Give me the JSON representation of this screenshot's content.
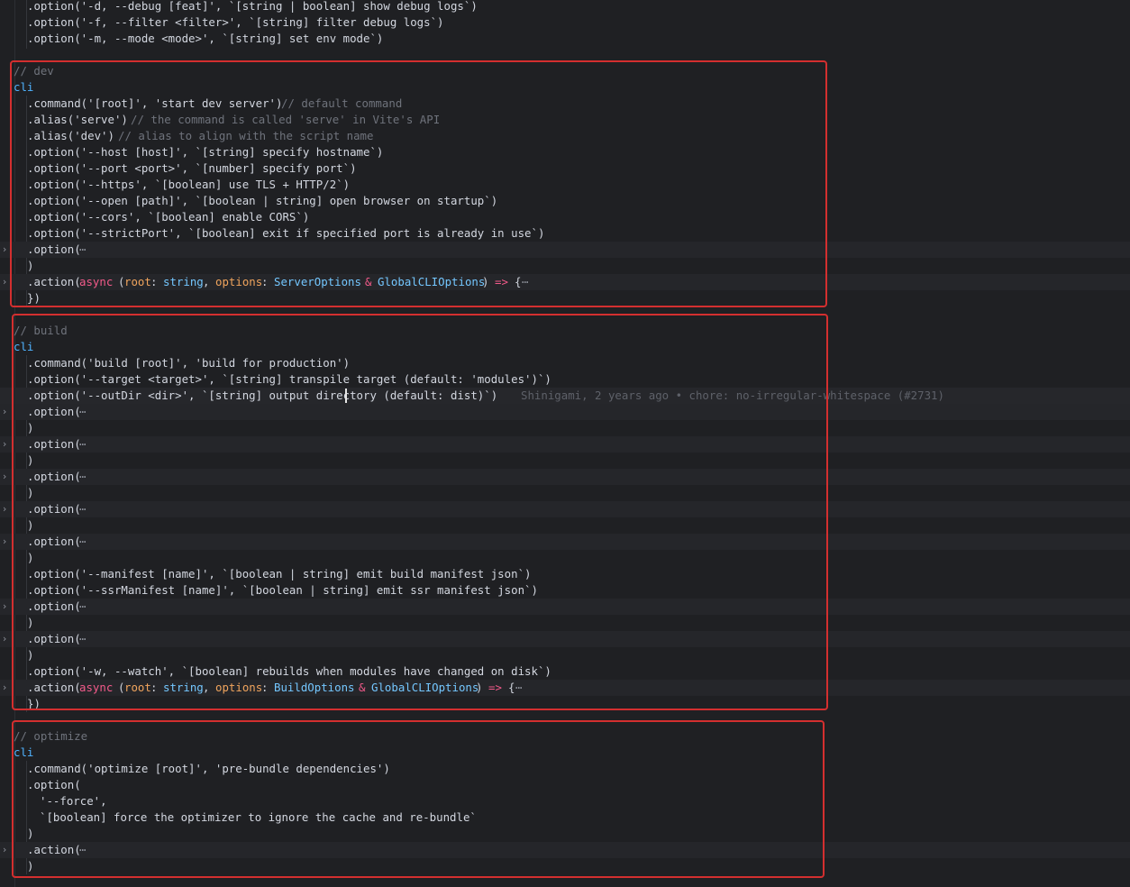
{
  "editor": {
    "fold_glyph": "›",
    "ellipsis": "⋯",
    "blame_annotation": "Shinigami, 2 years ago • chore: no-irregular-whitespace (#2731)",
    "colors": {
      "annotation_box": "#d32f2f",
      "identifier": "#4fb3ff",
      "keyword": "#f25a8a",
      "parameter": "#f0a45d"
    }
  },
  "lines": [
    {
      "text": ".option('-d, --debug [feat]', `[string | boolean] show debug logs`)"
    },
    {
      "text": ".option('-f, --filter <filter>', `[string] filter debug logs`)"
    },
    {
      "text": ".option('-m, --mode <mode>', `[string] set env mode`)"
    },
    {
      "text": "// dev"
    },
    {
      "text": "cli"
    },
    {
      "text": ".command('[root]', 'start dev server')",
      "comment": "// default command"
    },
    {
      "text": ".alias('serve')",
      "comment": "// the command is called 'serve' in Vite's API"
    },
    {
      "text": ".alias('dev')",
      "comment": "// alias to align with the script name"
    },
    {
      "text": ".option('--host [host]', `[string] specify hostname`)"
    },
    {
      "text": ".option('--port <port>', `[number] specify port`)"
    },
    {
      "text": ".option('--https', `[boolean] use TLS + HTTP/2`)"
    },
    {
      "text": ".option('--open [path]', `[boolean | string] open browser on startup`)"
    },
    {
      "text": ".option('--cors', `[boolean] enable CORS`)"
    },
    {
      "text": ".option('--strictPort', `[boolean] exit if specified port is already in use`)"
    },
    {
      "text": ".option("
    },
    {
      "text": ")"
    },
    {
      "text": ".action(",
      "kw": "async",
      "p1": "root",
      "t1": "string",
      "p2": "options",
      "t2": "ServerOptions",
      "amp": "&",
      "t3": "GlobalCLIOptions",
      "arrow": "=>",
      "tail": "{"
    },
    {
      "text": "})"
    },
    {
      "text": "// build"
    },
    {
      "text": "cli"
    },
    {
      "text": ".command('build [root]', 'build for production')"
    },
    {
      "text": ".option('--target <target>', `[string] transpile target (default: 'modules')`)"
    },
    {
      "text": ".option('--outDir <dir>', `[string] output directory (default: dist)`)"
    },
    {
      "text": ".option("
    },
    {
      "text": ")"
    },
    {
      "text": ".option("
    },
    {
      "text": ")"
    },
    {
      "text": ".option("
    },
    {
      "text": ")"
    },
    {
      "text": ".option("
    },
    {
      "text": ")"
    },
    {
      "text": ".option("
    },
    {
      "text": ")"
    },
    {
      "text": ".option('--manifest [name]', `[boolean | string] emit build manifest json`)"
    },
    {
      "text": ".option('--ssrManifest [name]', `[boolean | string] emit ssr manifest json`)"
    },
    {
      "text": ".option("
    },
    {
      "text": ")"
    },
    {
      "text": ".option("
    },
    {
      "text": ")"
    },
    {
      "text": ".option('-w, --watch', `[boolean] rebuilds when modules have changed on disk`)"
    },
    {
      "text": ".action(",
      "kw": "async",
      "p1": "root",
      "t1": "string",
      "p2": "options",
      "t2": "BuildOptions",
      "amp": "&",
      "t3": "GlobalCLIOptions",
      "arrow": "=>",
      "tail": "{"
    },
    {
      "text": "})"
    },
    {
      "text": "// optimize"
    },
    {
      "text": "cli"
    },
    {
      "text": ".command('optimize [root]', 'pre-bundle dependencies')"
    },
    {
      "text": ".option("
    },
    {
      "text": "'--force',"
    },
    {
      "text": "`[boolean] force the optimizer to ignore the cache and re-bundle`"
    },
    {
      "text": ")"
    },
    {
      "text": ".action("
    },
    {
      "text": ")"
    }
  ]
}
